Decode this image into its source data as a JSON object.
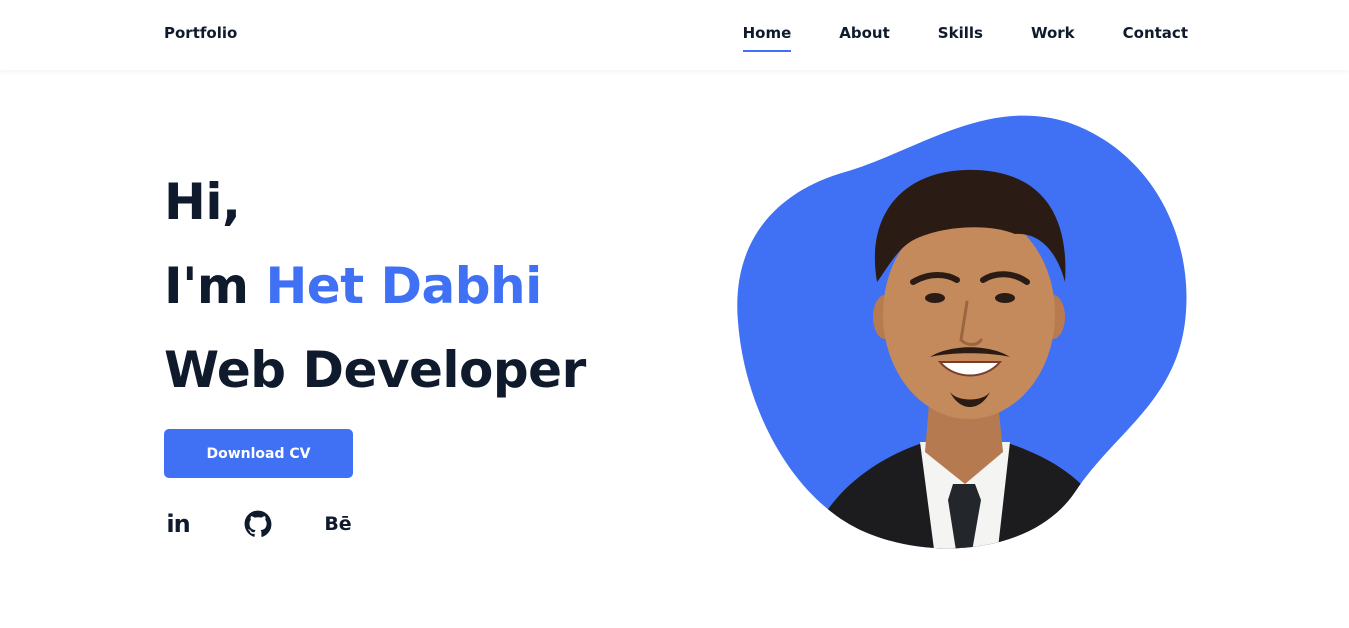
{
  "header": {
    "logo": "Portfolio",
    "nav": [
      {
        "label": "Home",
        "active": true
      },
      {
        "label": "About"
      },
      {
        "label": "Skills"
      },
      {
        "label": "Work"
      },
      {
        "label": "Contact"
      }
    ]
  },
  "hero": {
    "greeting": "Hi,",
    "intro_prefix": "I'm",
    "name": "Het Dabhi",
    "role": "Web Developer",
    "cta_label": "Download CV",
    "social": [
      {
        "name": "linkedin",
        "glyph": "in"
      },
      {
        "name": "github",
        "icon": "github-icon"
      },
      {
        "name": "behance",
        "glyph": "Bē"
      }
    ]
  },
  "colors": {
    "accent": "#4070f4",
    "text": "#0f1b2d",
    "background": "#ffffff"
  }
}
